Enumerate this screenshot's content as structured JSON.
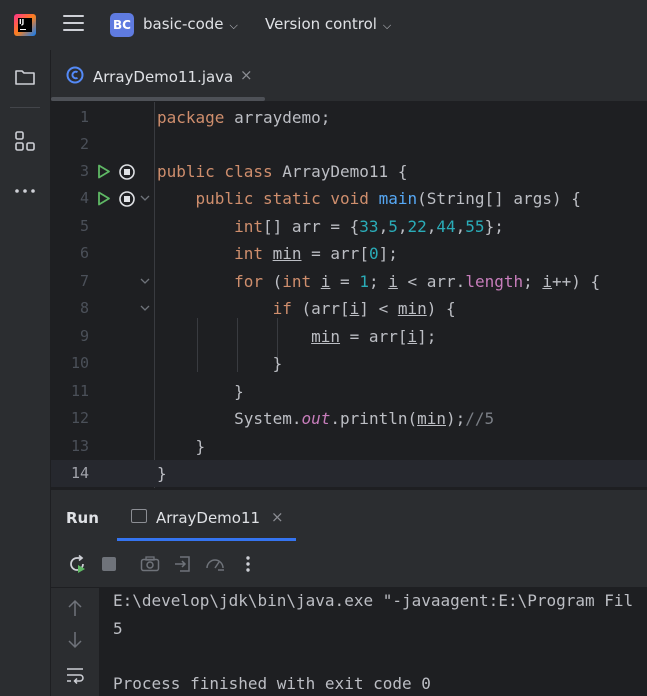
{
  "titlebar": {
    "project_badge": "BC",
    "project_name": "basic-code",
    "vcs_label": "Version control"
  },
  "editor": {
    "tab_label": "ArrayDemo11.java",
    "tab_close": "×",
    "lines": [
      {
        "n": "1"
      },
      {
        "n": "2"
      },
      {
        "n": "3"
      },
      {
        "n": "4"
      },
      {
        "n": "5"
      },
      {
        "n": "6"
      },
      {
        "n": "7"
      },
      {
        "n": "8"
      },
      {
        "n": "9"
      },
      {
        "n": "10"
      },
      {
        "n": "11"
      },
      {
        "n": "12"
      },
      {
        "n": "13"
      },
      {
        "n": "14"
      }
    ],
    "current_line": "14"
  },
  "run": {
    "title": "Run",
    "tab_label": "ArrayDemo11",
    "tab_close": "×",
    "console": [
      "E:\\develop\\jdk\\bin\\java.exe \"-javaagent:E:\\Program Fil",
      "5",
      "",
      "Process finished with exit code 0"
    ]
  },
  "icons": {
    "run_gutter": "run-triangle",
    "rerun": "rerun",
    "stop": "stop",
    "screenshot": "camera",
    "exit": "exit-arrow",
    "profiler": "gauge",
    "more": "more-vertical"
  },
  "colors": {
    "accent": "#3574f0",
    "keyword": "#cf8e6d",
    "number": "#2aacb8",
    "method": "#56a8f5",
    "field": "#c77dbb",
    "run_green": "#5fb865"
  }
}
